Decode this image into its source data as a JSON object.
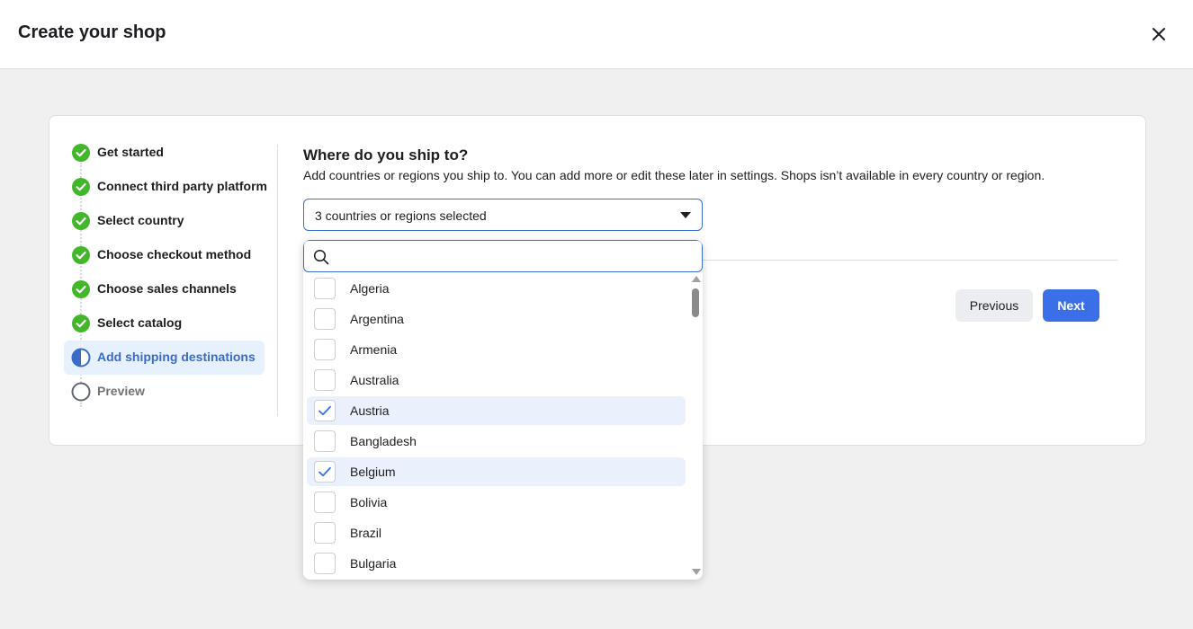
{
  "header": {
    "title": "Create your shop",
    "close_icon": "close-icon"
  },
  "steps": [
    {
      "label": "Get started",
      "status": "done"
    },
    {
      "label": "Connect third party platform",
      "status": "done"
    },
    {
      "label": "Select country",
      "status": "done"
    },
    {
      "label": "Choose checkout method",
      "status": "done"
    },
    {
      "label": "Choose sales channels",
      "status": "done"
    },
    {
      "label": "Select catalog",
      "status": "done"
    },
    {
      "label": "Add shipping destinations",
      "status": "active"
    },
    {
      "label": "Preview",
      "status": "pending"
    }
  ],
  "main": {
    "heading": "Where do you ship to?",
    "subtext": "Add countries or regions you ship to. You can add more or edit these later in settings. Shops isn’t available in every country or region.",
    "select_value": "3 countries or regions selected",
    "previous_label": "Previous",
    "next_label": "Next"
  },
  "dropdown": {
    "search_value": "",
    "options": [
      {
        "label": "Algeria",
        "checked": false
      },
      {
        "label": "Argentina",
        "checked": false
      },
      {
        "label": "Armenia",
        "checked": false
      },
      {
        "label": "Australia",
        "checked": false
      },
      {
        "label": "Austria",
        "checked": true
      },
      {
        "label": "Bangladesh",
        "checked": false
      },
      {
        "label": "Belgium",
        "checked": true
      },
      {
        "label": "Bolivia",
        "checked": false
      },
      {
        "label": "Brazil",
        "checked": false
      },
      {
        "label": "Bulgaria",
        "checked": false
      }
    ]
  },
  "colors": {
    "done": "#42b72a",
    "active": "#3a6bc8",
    "accent": "#3b6fe8"
  }
}
